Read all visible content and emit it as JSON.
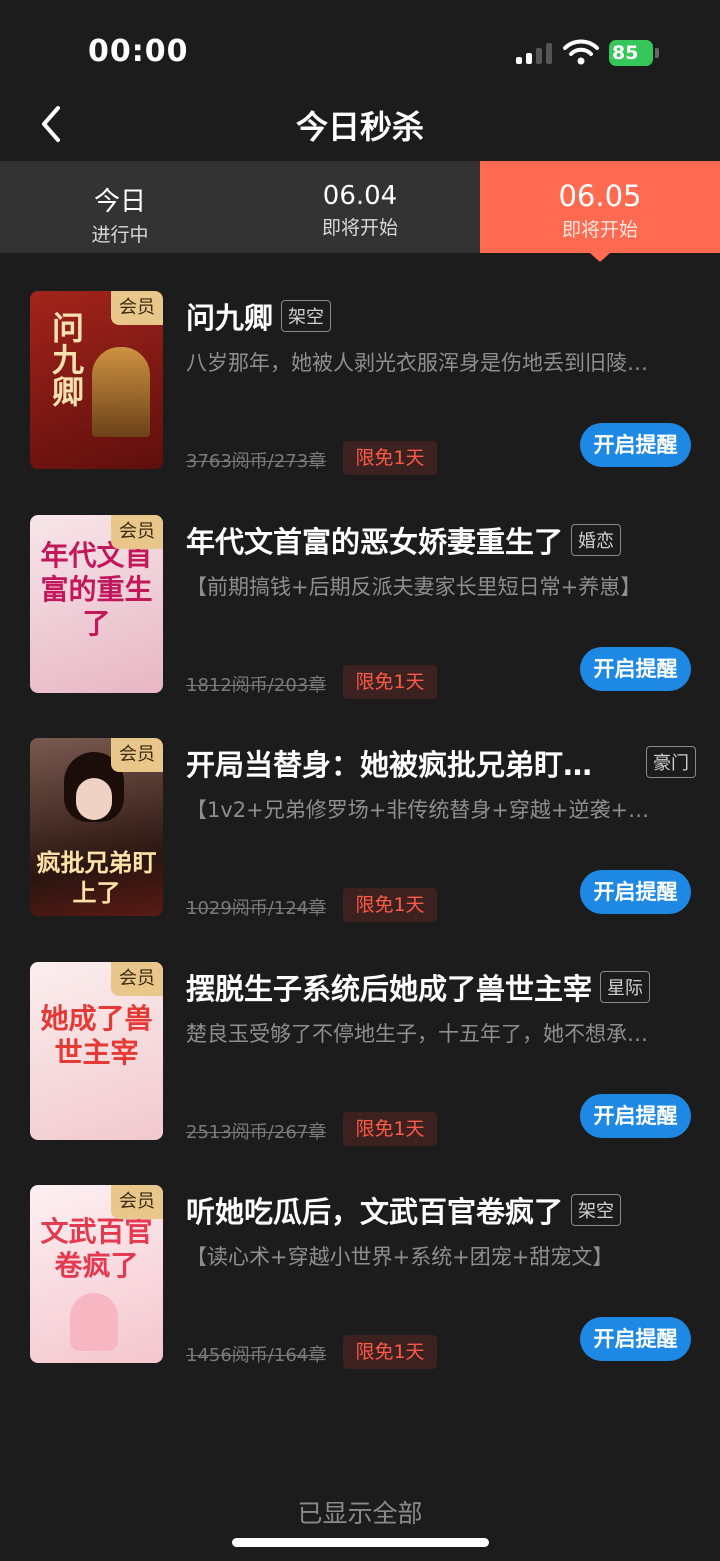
{
  "status_bar": {
    "time": "00:00",
    "battery": "85"
  },
  "nav": {
    "title": "今日秒杀"
  },
  "tabs": [
    {
      "line1": "今日",
      "line2": "进行中",
      "active": false
    },
    {
      "line1": "06.04",
      "line2": "即将开始",
      "active": false
    },
    {
      "line1": "06.05",
      "line2": "即将开始",
      "active": true
    }
  ],
  "books": [
    {
      "title": "问九卿",
      "tag": "架空",
      "desc": "八岁那年，她被人剥光衣服浑身是伤地丢到旧陵…",
      "price": "3763阅币/273章",
      "free": "限免1天",
      "button": "开启提醒",
      "badge": "会员",
      "cover_text": "问九卿",
      "cover_color": "#8b1a1a"
    },
    {
      "title": "年代文首富的恶女娇妻重生了",
      "tag": "婚恋",
      "desc": "【前期搞钱+后期反派夫妻家长里短日常+养崽】",
      "price": "1812阅币/203章",
      "free": "限免1天",
      "button": "开启提醒",
      "badge": "会员",
      "cover_text": "年代文首富的重生了",
      "cover_color": "#f3d9e0"
    },
    {
      "title": "开局当替身：她被疯批兄弟盯…",
      "tag": "豪门",
      "desc": "【1v2+兄弟修罗场+非传统替身+穿越+逆袭+…",
      "price": "1029阅币/124章",
      "free": "限免1天",
      "button": "开启提醒",
      "badge": "会员",
      "cover_text": "疯批兄弟盯上了",
      "cover_color": "#3a2420"
    },
    {
      "title": "摆脱生子系统后她成了兽世主宰",
      "tag": "星际",
      "desc": "楚良玉受够了不停地生子，十五年了，她不想承…",
      "price": "2513阅币/267章",
      "free": "限免1天",
      "button": "开启提醒",
      "badge": "会员",
      "cover_text": "她成了兽世主宰",
      "cover_color": "#f7e3e3"
    },
    {
      "title": "听她吃瓜后，文武百官卷疯了",
      "tag": "架空",
      "desc": "【读心术+穿越小世界+系统+团宠+甜宠文】",
      "price": "1456阅币/164章",
      "free": "限免1天",
      "button": "开启提醒",
      "badge": "会员",
      "cover_text": "文武百官卷疯了",
      "cover_color": "#fbe6ea"
    }
  ],
  "footer": {
    "text": "已显示全部"
  }
}
